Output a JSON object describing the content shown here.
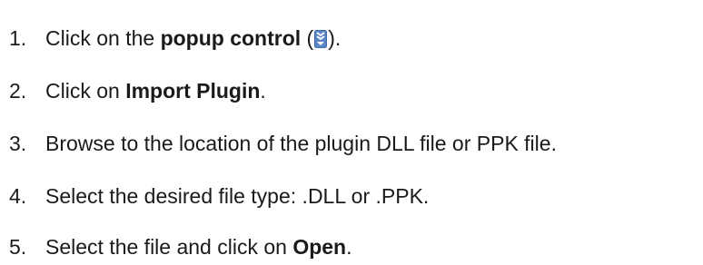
{
  "steps": [
    {
      "number": "1.",
      "before": "Click on the ",
      "bold": "popup control",
      "after_open": " (",
      "icon": "popup-control-icon",
      "after_close": ")."
    },
    {
      "number": "2.",
      "before": "Click on ",
      "bold": "Import Plugin",
      "after": "."
    },
    {
      "number": "3.",
      "text": "Browse to the location of the plugin DLL file or PPK file."
    },
    {
      "number": "4.",
      "text": "Select the desired file type: .DLL or .PPK."
    },
    {
      "number": "5.",
      "before": "Select the file and click on ",
      "bold": "Open",
      "after": "."
    }
  ],
  "colors": {
    "text": "#1a1a1a",
    "icon_bg": "#5b86c5",
    "icon_fg": "#ffffff"
  }
}
